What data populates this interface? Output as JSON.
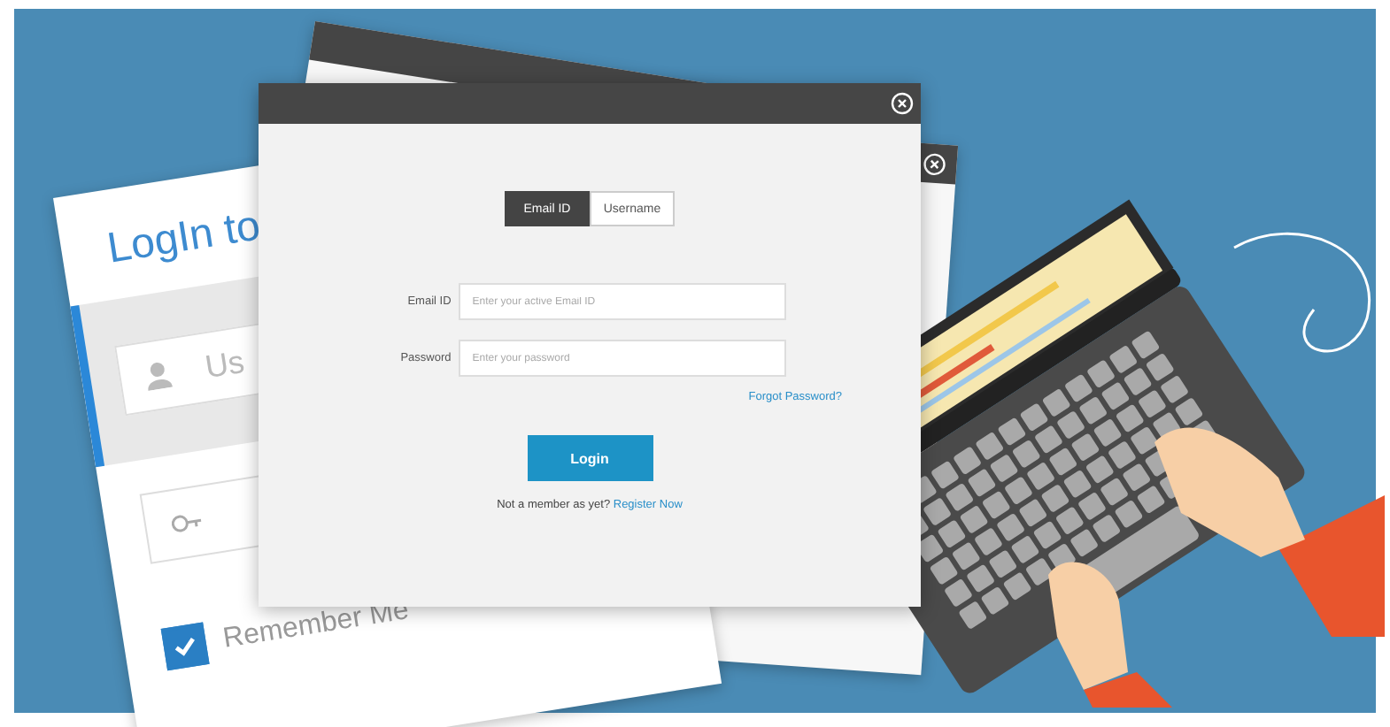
{
  "back_card": {
    "title": "LogIn to",
    "username_placeholder": "Us",
    "remember_label": "Remember Me",
    "remember_checked": true
  },
  "dialog": {
    "tabs": [
      {
        "label": "Email ID",
        "selected": true
      },
      {
        "label": "Username",
        "selected": false
      }
    ],
    "fields": [
      {
        "label": "Email ID",
        "placeholder": "Enter your active Email ID"
      },
      {
        "label": "Password",
        "placeholder": "Enter your password"
      }
    ],
    "forgot_link": "Forgot Password?",
    "login_button": "Login",
    "footer_text": "Not a member as yet?",
    "register_link": "Register Now"
  }
}
